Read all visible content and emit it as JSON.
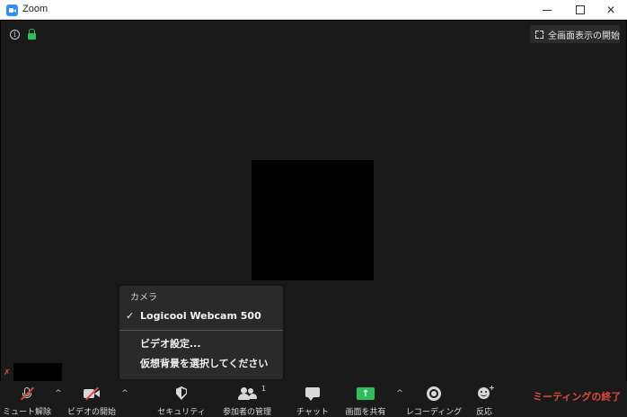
{
  "window": {
    "title": "Zoom"
  },
  "header": {
    "fullscreen_label": "全画面表示の開始"
  },
  "menu": {
    "header": "カメラ",
    "camera_item": "Logicool Webcam 500",
    "check": "✓",
    "video_settings": "ビデオ設定...",
    "choose_background": "仮想背景を選択してください"
  },
  "toolbar": {
    "unmute": "ミュート解除",
    "start_video": "ビデオの開始",
    "security": "セキュリティ",
    "participants": "参加者の管理",
    "participant_count": "1",
    "chat": "チャット",
    "share": "画面を共有",
    "record": "レコーディング",
    "reactions": "反応",
    "end": "ミーティングの終了"
  },
  "colors": {
    "accent_red": "#e0483e",
    "accent_green": "#2fbf5a",
    "brand_blue": "#2d8cff"
  }
}
